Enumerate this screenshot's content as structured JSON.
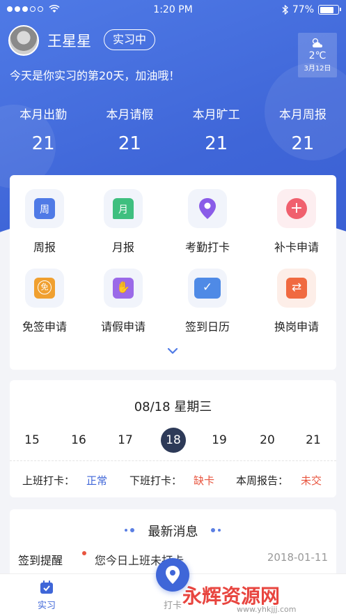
{
  "status_bar": {
    "time": "1:20 PM",
    "battery": "77%"
  },
  "profile": {
    "name": "王星星",
    "status_badge": "实习中",
    "greeting": "今天是你实习的第20天，加油哦！"
  },
  "weather": {
    "icon": "partly-cloudy-icon",
    "temp": "2℃",
    "date": "3月12日"
  },
  "stats": [
    {
      "label": "本月出勤",
      "value": "21"
    },
    {
      "label": "本月请假",
      "value": "21"
    },
    {
      "label": "本月旷工",
      "value": "21"
    },
    {
      "label": "本月周报",
      "value": "21"
    }
  ],
  "menu": [
    {
      "label": "周报",
      "icon": "weekly-report-icon",
      "icon_char": "周",
      "color": "#4f7ae6"
    },
    {
      "label": "月报",
      "icon": "monthly-report-icon",
      "icon_char": "月",
      "color": "#3fbf7f"
    },
    {
      "label": "考勤打卡",
      "icon": "location-pin-icon",
      "icon_char": "",
      "color": "#8a5ce8"
    },
    {
      "label": "补卡申请",
      "icon": "plus-icon",
      "icon_char": "+",
      "color": "#f0606e"
    },
    {
      "label": "免签申请",
      "icon": "exempt-icon",
      "icon_char": "免",
      "color": "#f0a030"
    },
    {
      "label": "请假申请",
      "icon": "hand-icon",
      "icon_char": "✋",
      "color": "#9b6ae8"
    },
    {
      "label": "签到日历",
      "icon": "calendar-check-icon",
      "icon_char": "✓",
      "color": "#4f8ae6"
    },
    {
      "label": "换岗申请",
      "icon": "swap-icon",
      "icon_char": "⇄",
      "color": "#f06a40"
    }
  ],
  "calendar": {
    "title": "08/18 星期三",
    "days": [
      "15",
      "16",
      "17",
      "18",
      "19",
      "20",
      "21"
    ],
    "selected": "18",
    "checkin_label": "上班打卡：",
    "checkin_value": "正常",
    "checkout_label": "下班打卡：",
    "checkout_value": "缺卡",
    "weekly_label": "本周报告：",
    "weekly_value": "未交"
  },
  "news": {
    "title": "最新消息",
    "items": [
      {
        "tag": "签到提醒",
        "text": "您今日上班未打卡",
        "date": "2018-01-11"
      }
    ]
  },
  "tabbar": {
    "tabs": [
      {
        "label": "实习",
        "icon": "internship-icon"
      },
      {
        "label": "打卡",
        "icon": "location-pin-icon"
      }
    ]
  },
  "watermark": {
    "text": "永辉资源网",
    "url": "www.yhkjjj.com"
  },
  "colors": {
    "primary": "#3f66d8",
    "ok": "#3f66d8",
    "bad": "#e8553f"
  }
}
